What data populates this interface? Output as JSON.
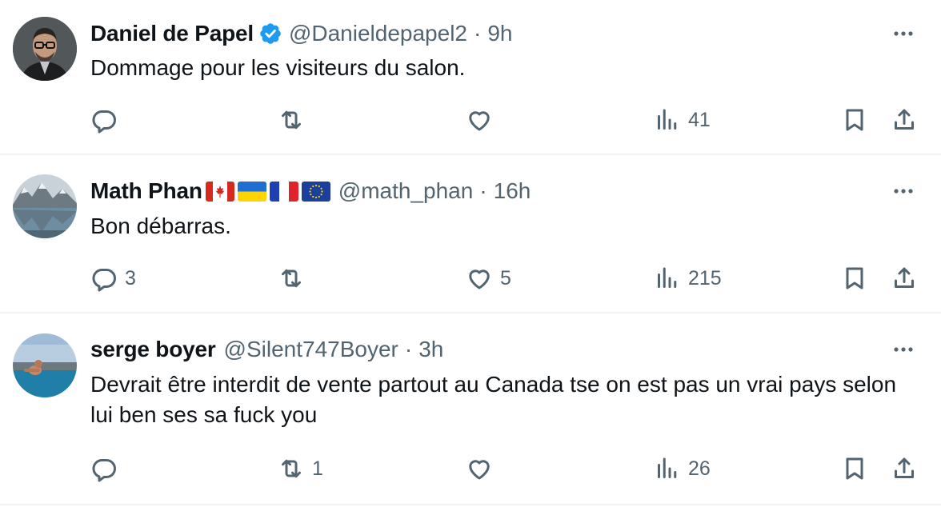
{
  "tweets": [
    {
      "name": "Daniel de Papel",
      "verified": true,
      "handle": "@Danieldepapel2",
      "separator": "·",
      "time": "9h",
      "text": "Dommage pour les visiteurs du salon.",
      "replies": "",
      "retweets": "",
      "likes": "",
      "views": "41"
    },
    {
      "name": "Math Phan",
      "flags": [
        "canada-flag",
        "ukraine-flag",
        "france-flag",
        "eu-flag"
      ],
      "handle": "@math_phan",
      "separator": "·",
      "time": "16h",
      "text": "Bon débarras.",
      "replies": "3",
      "retweets": "",
      "likes": "5",
      "views": "215"
    },
    {
      "name": "serge boyer",
      "handle": "@Silent747Boyer",
      "separator": "·",
      "time": "3h",
      "text": "Devrait être interdit de vente partout au Canada tse on est pas un vrai pays selon lui ben ses sa fuck you",
      "replies": "",
      "retweets": "1",
      "likes": "",
      "views": "26"
    }
  ],
  "icons": {
    "reply": "reply-icon",
    "retweet": "retweet-icon",
    "like": "heart-icon",
    "views": "views-icon",
    "bookmark": "bookmark-icon",
    "share": "share-icon",
    "more": "more-icon",
    "verified": "verified-badge-icon"
  },
  "colors": {
    "verified": "#1d9bf0",
    "secondary_text": "#536471",
    "divider": "#eff3f4"
  }
}
